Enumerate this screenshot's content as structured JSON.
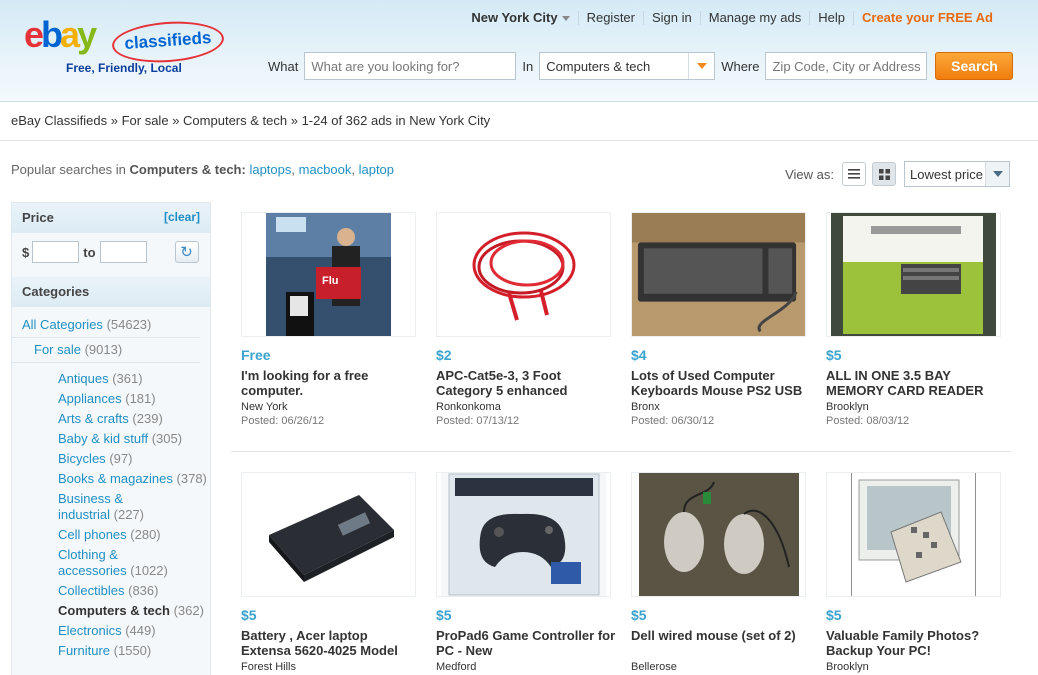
{
  "logo": {
    "tagline": "Free, Friendly, Local",
    "part1": "e",
    "part2": "b",
    "part3": "a",
    "part4": "y",
    "badge": "classifieds"
  },
  "topnav": {
    "city": "New York City",
    "register": "Register",
    "signin": "Sign in",
    "manage": "Manage my ads",
    "help": "Help",
    "create": "Create your FREE Ad"
  },
  "search": {
    "what_label": "What",
    "what_placeholder": "What are you looking for?",
    "in_label": "In",
    "category": "Computers & tech",
    "where_label": "Where",
    "where_placeholder": "Zip Code, City or Address",
    "button": "Search"
  },
  "breadcrumb": {
    "root": "eBay Classifieds",
    "sep": "»",
    "level1": "For sale",
    "level2": "Computers & tech",
    "summary": "1-24 of 362 ads in New York City"
  },
  "popular": {
    "prefix": "Popular searches in",
    "category": "Computers & tech:",
    "terms": [
      "laptops",
      "macbook",
      "laptop"
    ]
  },
  "view": {
    "label": "View as:",
    "sort": "Lowest price"
  },
  "sidebar": {
    "price_title": "Price",
    "clear": "[clear]",
    "currency": "$",
    "to": "to",
    "categories_title": "Categories",
    "all": {
      "label": "All Categories",
      "count": "(54623)"
    },
    "forsale": {
      "label": "For sale",
      "count": "(9013)"
    },
    "items": [
      {
        "label": "Antiques",
        "count": "(361)"
      },
      {
        "label": "Appliances",
        "count": "(181)"
      },
      {
        "label": "Arts & crafts",
        "count": "(239)"
      },
      {
        "label": "Baby & kid stuff",
        "count": "(305)"
      },
      {
        "label": "Bicycles",
        "count": "(97)"
      },
      {
        "label": "Books & magazines",
        "count": "(378)"
      },
      {
        "label": "Business &",
        "label2": "industrial",
        "count": "(227)"
      },
      {
        "label": "Cell phones",
        "count": "(280)"
      },
      {
        "label": "Clothing &",
        "label2": "accessories",
        "count": "(1022)"
      },
      {
        "label": "Collectibles",
        "count": "(836)"
      },
      {
        "label": "Computers & tech",
        "count": "(362)"
      },
      {
        "label": "Electronics",
        "count": "(449)"
      },
      {
        "label": "Furniture",
        "count": "(1550)"
      }
    ]
  },
  "listings": [
    {
      "price": "Free",
      "title": "I'm looking for a free computer.",
      "location": "New York",
      "posted": "Posted: 06/26/12"
    },
    {
      "price": "$2",
      "title": "APC-Cat5e-3, 3 Foot Category 5 enhanced",
      "location": "Ronkonkoma",
      "posted": "Posted: 07/13/12"
    },
    {
      "price": "$4",
      "title": "Lots of Used Computer Keyboards Mouse PS2 USB",
      "location": "Bronx",
      "posted": "Posted: 06/30/12"
    },
    {
      "price": "$5",
      "title": "ALL IN ONE 3.5 BAY MEMORY CARD READER",
      "location": "Brooklyn",
      "posted": "Posted: 08/03/12"
    },
    {
      "price": "$5",
      "title": "Battery , Acer laptop Extensa 5620-4025 Model",
      "location": "Forest Hills",
      "posted": ""
    },
    {
      "price": "$5",
      "title": "ProPad6 Game Controller for PC - New",
      "location": "Medford",
      "posted": ""
    },
    {
      "price": "$5",
      "title": "Dell wired mouse (set of 2)",
      "location": "Bellerose",
      "posted": ""
    },
    {
      "price": "$5",
      "title": "Valuable Family Photos? Backup Your PC!",
      "location": "Brooklyn",
      "posted": ""
    }
  ],
  "colors": {
    "accent_orange": "#f07d0e",
    "link_blue": "#1f8fc4",
    "price_blue": "#3aa2cf"
  }
}
